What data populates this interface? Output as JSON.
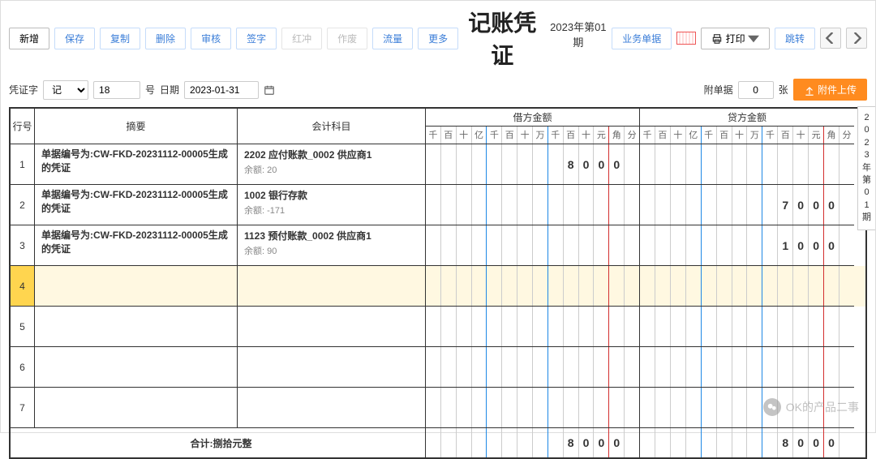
{
  "toolbar": {
    "new": "新增",
    "save": "保存",
    "copy": "复制",
    "delete": "删除",
    "audit": "审核",
    "sign": "签字",
    "red": "红冲",
    "void": "作废",
    "flow": "流量",
    "more": "更多",
    "biz_doc": "业务单据",
    "print": "打印",
    "jump": "跳转"
  },
  "title": "记账凭证",
  "period": "2023年第01期",
  "bar2": {
    "voucher_word_label": "凭证字",
    "voucher_word_value": "记",
    "voucher_no": "18",
    "no_label": "号",
    "date_label": "日期",
    "date_value": "2023-01-31",
    "att_label": "附单据",
    "att_value": "0",
    "att_unit": "张",
    "upload": "附件上传"
  },
  "headers": {
    "row_no": "行号",
    "summary": "摘要",
    "account": "会计科目",
    "debit": "借方金额",
    "credit": "贷方金额"
  },
  "digit_labels": [
    "千",
    "百",
    "十",
    "亿",
    "千",
    "百",
    "十",
    "万",
    "千",
    "百",
    "十",
    "元",
    "角",
    "分"
  ],
  "rows": [
    {
      "no": "1",
      "summary": "单据编号为:CW-FKD-20231112-00005生成的凭证",
      "account": "2202  应付账款_0002 供应商1",
      "balance": "余额: 20",
      "debit": [
        "",
        "",
        "",
        "",
        "",
        "",
        "",
        "",
        "",
        "8",
        "0",
        "0",
        "0",
        ""
      ],
      "credit": [
        "",
        "",
        "",
        "",
        "",
        "",
        "",
        "",
        "",
        "",
        "",
        "",
        "",
        ""
      ]
    },
    {
      "no": "2",
      "summary": "单据编号为:CW-FKD-20231112-00005生成的凭证",
      "account": "1002  银行存款",
      "balance": "余额: -171",
      "debit": [
        "",
        "",
        "",
        "",
        "",
        "",
        "",
        "",
        "",
        "",
        "",
        "",
        "",
        ""
      ],
      "credit": [
        "",
        "",
        "",
        "",
        "",
        "",
        "",
        "",
        "",
        "7",
        "0",
        "0",
        "0",
        ""
      ]
    },
    {
      "no": "3",
      "summary": "单据编号为:CW-FKD-20231112-00005生成的凭证",
      "account": "1123  预付账款_0002 供应商1",
      "balance": "余额: 90",
      "debit": [
        "",
        "",
        "",
        "",
        "",
        "",
        "",
        "",
        "",
        "",
        "",
        "",
        "",
        ""
      ],
      "credit": [
        "",
        "",
        "",
        "",
        "",
        "",
        "",
        "",
        "",
        "1",
        "0",
        "0",
        "0",
        ""
      ]
    },
    {
      "no": "4",
      "summary": "",
      "account": "",
      "balance": "",
      "debit": [
        "",
        "",
        "",
        "",
        "",
        "",
        "",
        "",
        "",
        "",
        "",
        "",
        "",
        ""
      ],
      "credit": [
        "",
        "",
        "",
        "",
        "",
        "",
        "",
        "",
        "",
        "",
        "",
        "",
        "",
        ""
      ],
      "selected": true
    },
    {
      "no": "5",
      "summary": "",
      "account": "",
      "balance": "",
      "debit": [
        "",
        "",
        "",
        "",
        "",
        "",
        "",
        "",
        "",
        "",
        "",
        "",
        "",
        ""
      ],
      "credit": [
        "",
        "",
        "",
        "",
        "",
        "",
        "",
        "",
        "",
        "",
        "",
        "",
        "",
        ""
      ]
    },
    {
      "no": "6",
      "summary": "",
      "account": "",
      "balance": "",
      "debit": [
        "",
        "",
        "",
        "",
        "",
        "",
        "",
        "",
        "",
        "",
        "",
        "",
        "",
        ""
      ],
      "credit": [
        "",
        "",
        "",
        "",
        "",
        "",
        "",
        "",
        "",
        "",
        "",
        "",
        "",
        ""
      ]
    },
    {
      "no": "7",
      "summary": "",
      "account": "",
      "balance": "",
      "debit": [
        "",
        "",
        "",
        "",
        "",
        "",
        "",
        "",
        "",
        "",
        "",
        "",
        "",
        ""
      ],
      "credit": [
        "",
        "",
        "",
        "",
        "",
        "",
        "",
        "",
        "",
        "",
        "",
        "",
        "",
        ""
      ]
    }
  ],
  "total": {
    "label": "合计:捌拾元整",
    "debit": [
      "",
      "",
      "",
      "",
      "",
      "",
      "",
      "",
      "",
      "8",
      "0",
      "0",
      "0",
      ""
    ],
    "credit": [
      "",
      "",
      "",
      "",
      "",
      "",
      "",
      "",
      "",
      "8",
      "0",
      "0",
      "0",
      ""
    ]
  },
  "side_tab": "2023年第01期",
  "watermark": "OK的产品二事"
}
